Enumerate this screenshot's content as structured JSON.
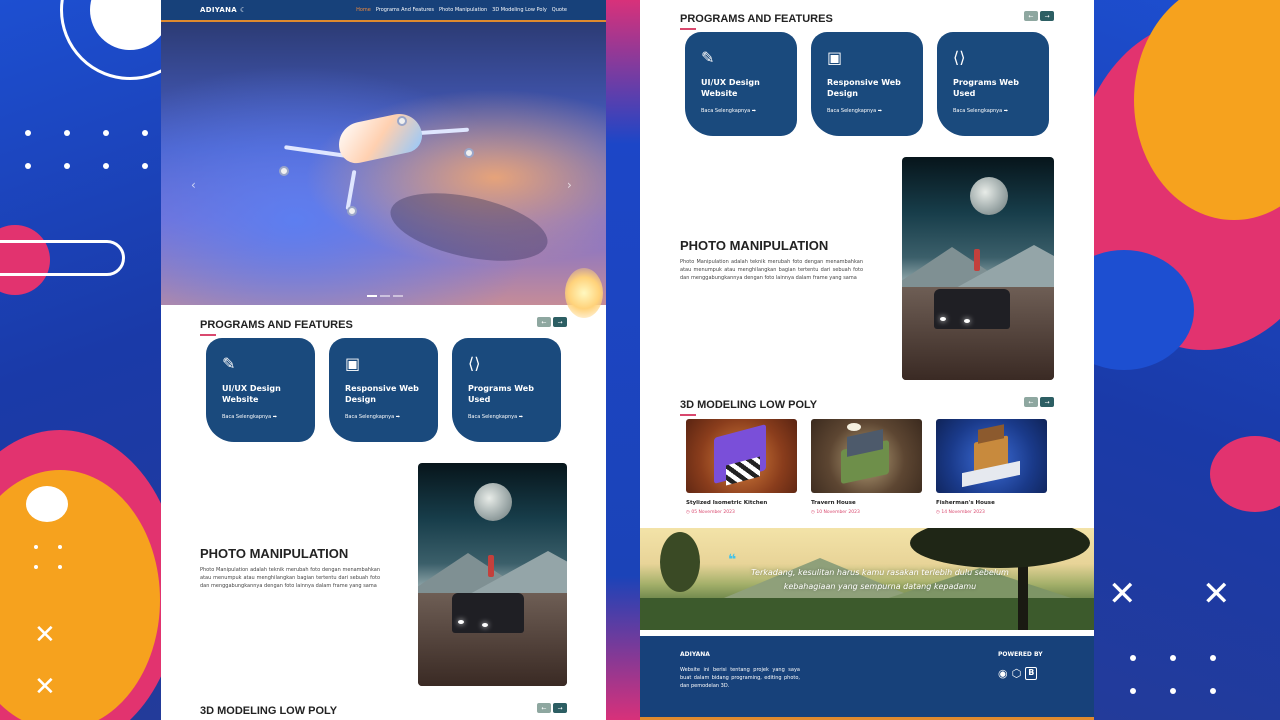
{
  "colors": {
    "navbar": "#17417a",
    "accent_orange": "#e08a2e",
    "card_blue": "#1a4a7d",
    "title_underline": "#d9486e",
    "arrow_next": "#2c5e63",
    "arrow_prev": "#8ea7a0"
  },
  "navbar": {
    "brand": "ADIYANA",
    "brand_icon": "moon-icon",
    "links": [
      "Home",
      "Programs And Features",
      "Photo Manipulation",
      "3D Modeling Low Poly",
      "Quote"
    ],
    "active_index": 0
  },
  "hero": {
    "prev_glyph": "‹",
    "next_glyph": "›",
    "slide_count": 3,
    "active_slide": 1
  },
  "programs": {
    "title": "PROGRAMS AND FEATURES",
    "prev_glyph": "←",
    "next_glyph": "→",
    "cards": [
      {
        "icon": "pencil-ruler-icon",
        "icon_glyph": "✎",
        "title": "UI/UX Design Website",
        "link": "Baca Selengkapnya ➡"
      },
      {
        "icon": "images-icon",
        "icon_glyph": "▣",
        "title": "Responsive Web Design",
        "link": "Baca Selengkapnya ➡"
      },
      {
        "icon": "code-file-icon",
        "icon_glyph": "⟨⟩",
        "title": "Programs Web Used",
        "link": "Baca Selengkapnya ➡"
      }
    ]
  },
  "photo": {
    "title": "PHOTO MANIPULATION",
    "text": "Photo Manipulation adalah teknik merubah foto dengan menambahkan atau menumpuk atau menghilangkan bagian tertentu dari sebuah foto dan menggabungkannya dengan foto lainnya dalam frame yang sama"
  },
  "modeling": {
    "title": "3D MODELING LOW POLY",
    "prev_glyph": "←",
    "next_glyph": "→",
    "items": [
      {
        "name": "Stylized Isometric Kitchen",
        "date": "◷ 05 November 2023"
      },
      {
        "name": "Travern House",
        "date": "◷ 10 November 2023"
      },
      {
        "name": "Fisherman's House",
        "date": "◷ 14 November 2023"
      }
    ]
  },
  "quote": {
    "icon": "quote-icon",
    "icon_glyph": "❝",
    "text": "Terkadang, kesulitan harus kamu rasakan terlebih dulu sebelum kebahagiaan yang sempurna datang kepadamu"
  },
  "footer": {
    "brand": "ADIYANA",
    "desc": "Website ini berisi tentang projek yang saya buat dalam bidang programing, editing photo, dan pemodelan 3D.",
    "powered": "POWERED BY",
    "icons": [
      {
        "name": "github-icon",
        "glyph": "◉"
      },
      {
        "name": "codepen-icon",
        "glyph": "⬡"
      },
      {
        "name": "bootstrap-icon",
        "glyph": "B"
      }
    ]
  }
}
